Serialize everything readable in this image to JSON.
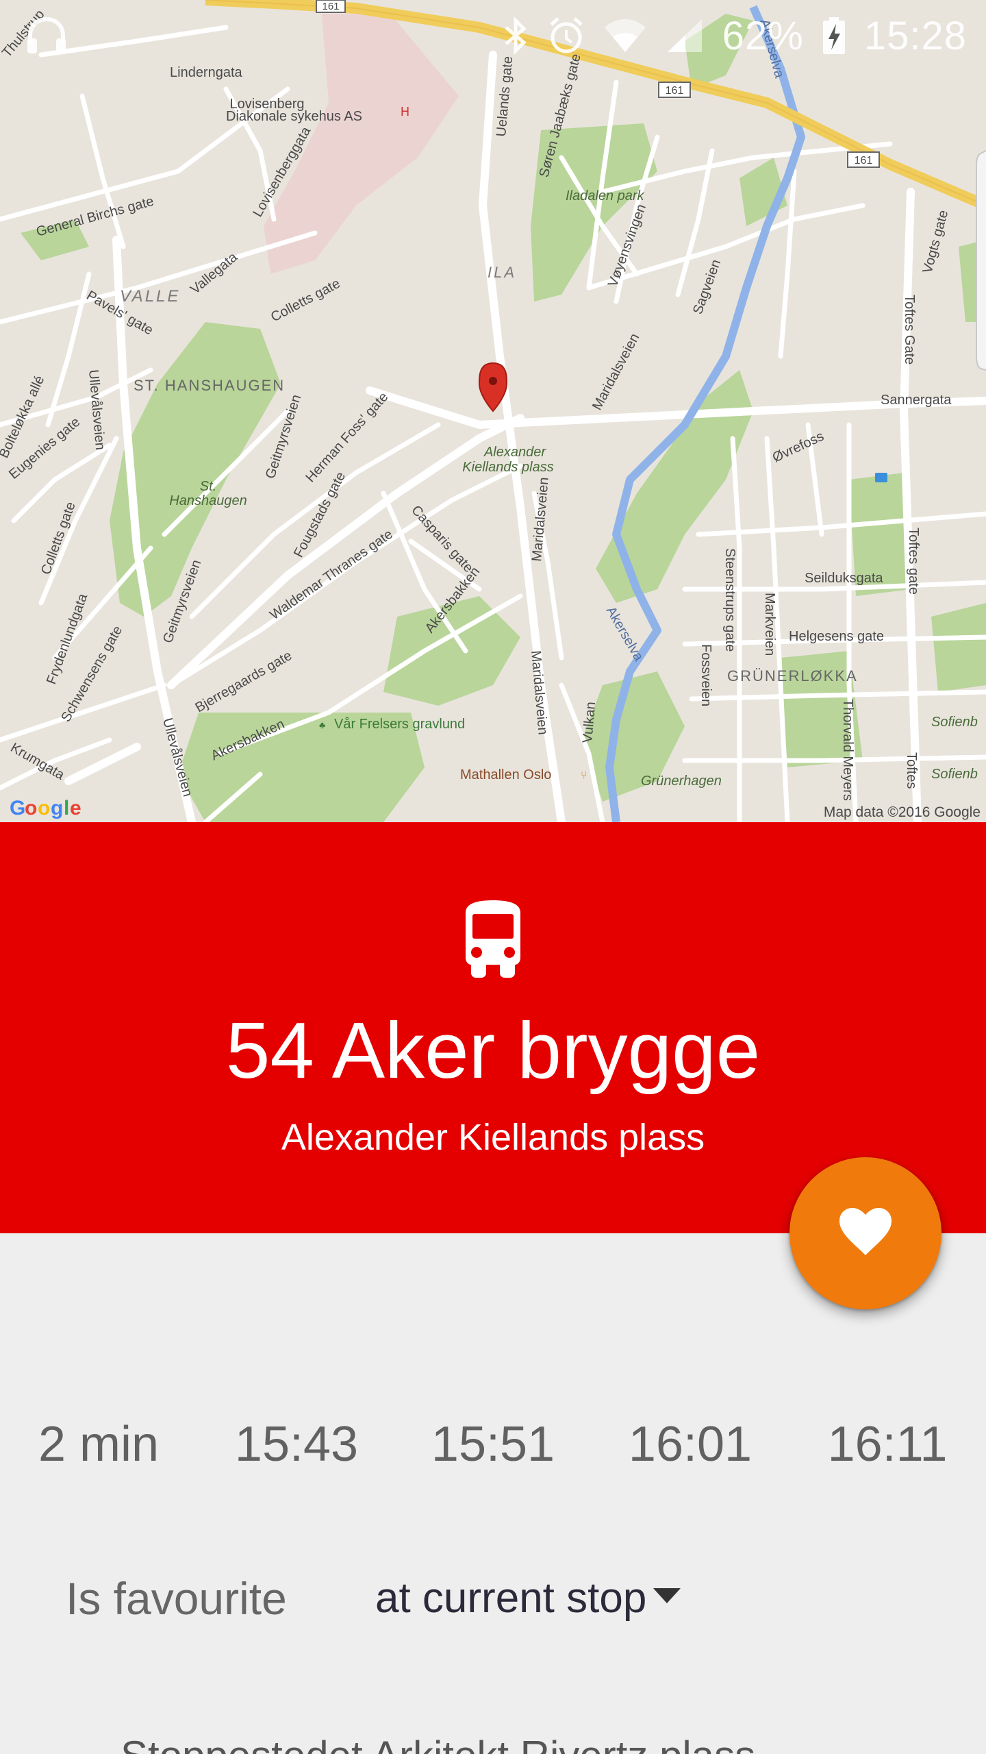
{
  "status_bar": {
    "battery": "62%",
    "time": "15:28",
    "icons": [
      "headset-icon",
      "bluetooth-icon",
      "alarm-icon",
      "wifi-icon",
      "signal-icon",
      "battery-charging-icon"
    ]
  },
  "map": {
    "attribution": "Map data ©2016 Google",
    "logo_text": "Google",
    "labels": {
      "thulstrup": "Thulstrup",
      "lindern": "Linderngata",
      "lovisenberg1": "Lovisenberg",
      "lovisenberg2": "Diakonale sykehus AS",
      "uelands": "Uelands gate",
      "jaabaeks": "Søren Jaabæks gate",
      "iladalen": "Iladalen park",
      "general": "General Birchs gate",
      "lovisenbergg": "Lovisenberggata",
      "valle": "VALLE",
      "vallegata": "Vallegata",
      "ila": "ILA",
      "colletts": "Colletts gate",
      "pavels": "Pavels' gate",
      "voyens": "Vøyensvingen",
      "sagveien": "Sagveien",
      "akerselva1": "Akerselva",
      "vogts": "Vogts gate",
      "toftes1": "Toftes Gate",
      "sanner": "Sannergata",
      "sthans": "ST. HANSHAUGEN",
      "maridal1": "Maridalsveien",
      "ulleval1": "Ullevålsveien",
      "bolteloka": "Bolteløkka allé",
      "eugenies": "Eugenies gate",
      "geitmyr1": "Geitmyrsveien",
      "hermanfoss": "Herman Foss' gate",
      "alexk1": "Alexander",
      "alexk2": "Kiellands plass",
      "ovrefoss": "Øvrefoss",
      "sthans_park1": "St.",
      "sthans_park2": "Hanshaugen",
      "fougstads": "Fougstads gate",
      "colletts2": "Colletts gate",
      "maridal2": "Maridalsveien",
      "casparis": "Casparis gate",
      "toftes2": "Toftes gate",
      "waldemar": "Waldemar Thranes gate",
      "seilduks": "Seilduksgata",
      "steenstrups": "Steenstrups gate",
      "markveien": "Markveien",
      "helgesens": "Helgesens gate",
      "akersbakken1": "Akersbakken",
      "geitmyr2": "Geitmyrsveien",
      "frydenlund": "Frydenlundgata",
      "schwensens": "Schwensens gate",
      "akerselva2": "Akerselva",
      "fossveien": "Fossveien",
      "grunerlokka": "GRÜNERLØKKA",
      "sofienb1": "Sofienb",
      "bjerregaards": "Bjerregaards gate",
      "ulleval2": "Ullevålsveien",
      "varfrelsers": "Vår Frelsers gravlund",
      "maridal3": "Maridalsveien",
      "vulkan": "Vulkan",
      "thorvald": "Thorvald Meyers",
      "akersbakken2": "Akersbakken",
      "krumgata": "Krumgata",
      "mathallen": "Mathallen Oslo",
      "grunerhagen": "Grünerhagen",
      "toftes3": "Toftes",
      "sofienb2": "Sofienb",
      "road161a": "161",
      "road161b": "161",
      "road161c": "161"
    }
  },
  "header": {
    "route": "54 Aker brygge",
    "stop": "Alexander Kiellands plass",
    "background_color": "#e50000"
  },
  "fab": {
    "icon": "heart-icon",
    "color": "#f07a0c"
  },
  "departures": [
    "2 min",
    "15:43",
    "15:51",
    "16:01",
    "16:11"
  ],
  "favourite": {
    "label": "Is favourite",
    "selected": "at current stop"
  },
  "footer": {
    "text": "Stoppestedet Arkitekt Rivertz plass"
  }
}
